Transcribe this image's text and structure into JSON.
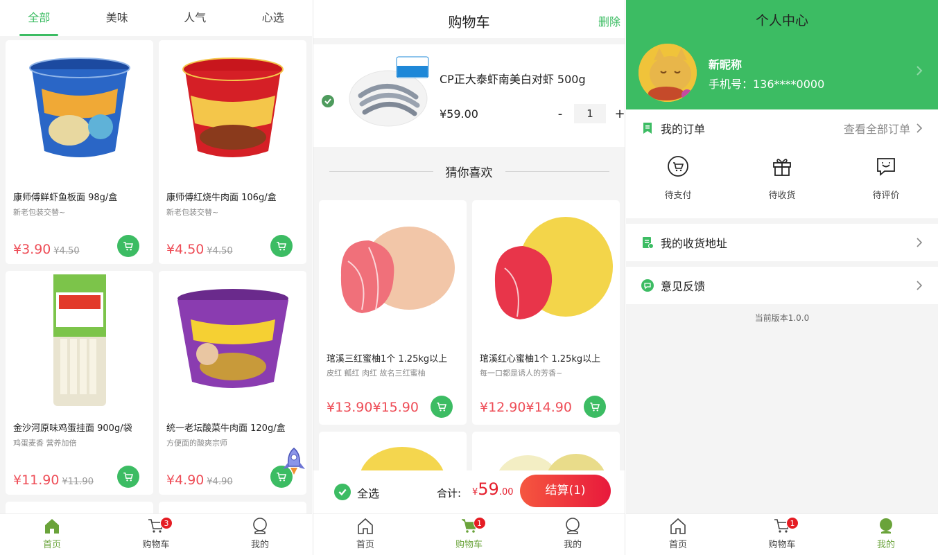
{
  "colors": {
    "accent": "#3cbc63",
    "price": "#ee4d57",
    "badge": "#e51c23"
  },
  "home": {
    "tabs": [
      "全部",
      "美味",
      "人气",
      "心选"
    ],
    "products": [
      {
        "name": "康师傅鲜虾鱼板面 98g/盒",
        "desc": "新老包装交替~",
        "price": "¥3.90",
        "old": "¥4.50"
      },
      {
        "name": "康师傅红烧牛肉面 106g/盒",
        "desc": "新老包装交替~",
        "price": "¥4.50",
        "old": "¥4.50"
      },
      {
        "name": "金沙河原味鸡蛋挂面 900g/袋",
        "desc": "鸡蛋麦香 营养加倍",
        "price": "¥11.90",
        "old": "¥11.90"
      },
      {
        "name": "统一老坛酸菜牛肉面 120g/盒",
        "desc": "方便面的酸爽宗师",
        "price": "¥4.90",
        "old": "¥4.90"
      }
    ],
    "tabbar": [
      {
        "label": "首页"
      },
      {
        "label": "购物车",
        "badge": "3"
      },
      {
        "label": "我的"
      }
    ]
  },
  "cart": {
    "title": "购物车",
    "delete": "删除",
    "item": {
      "name": "CP正大泰虾南美白对虾 500g",
      "price": "¥59.00",
      "qty": "1",
      "minus": "-",
      "plus": "+"
    },
    "guess_title": "猜你喜欢",
    "products": [
      {
        "name": "琯溪三红蜜柚1个 1.25kg以上",
        "desc": "皮红 瓤红 肉红 故名三红蜜柚",
        "price": "¥13.90",
        "old": "¥15.90"
      },
      {
        "name": "琯溪红心蜜柚1个 1.25kg以上",
        "desc": "每一口都是诱人的芳香~",
        "price": "¥12.90",
        "old": "¥14.90"
      }
    ],
    "select_all": "全选",
    "total_label": "合计:",
    "total_symbol": "¥",
    "total_int": "59",
    "total_dec": ".00",
    "checkout": "结算(1)",
    "tabbar": [
      {
        "label": "首页"
      },
      {
        "label": "购物车",
        "badge": "1"
      },
      {
        "label": "我的"
      }
    ]
  },
  "profile": {
    "title": "个人中心",
    "nickname": "新昵称",
    "phone": "手机号：136****0000",
    "orders_title": "我的订单",
    "orders_all": "查看全部订单",
    "order_states": [
      "待支付",
      "待收货",
      "待评价"
    ],
    "address": "我的收货地址",
    "feedback": "意见反馈",
    "version": "当前版本1.0.0",
    "tabbar": [
      {
        "label": "首页"
      },
      {
        "label": "购物车",
        "badge": "1"
      },
      {
        "label": "我的"
      }
    ]
  }
}
